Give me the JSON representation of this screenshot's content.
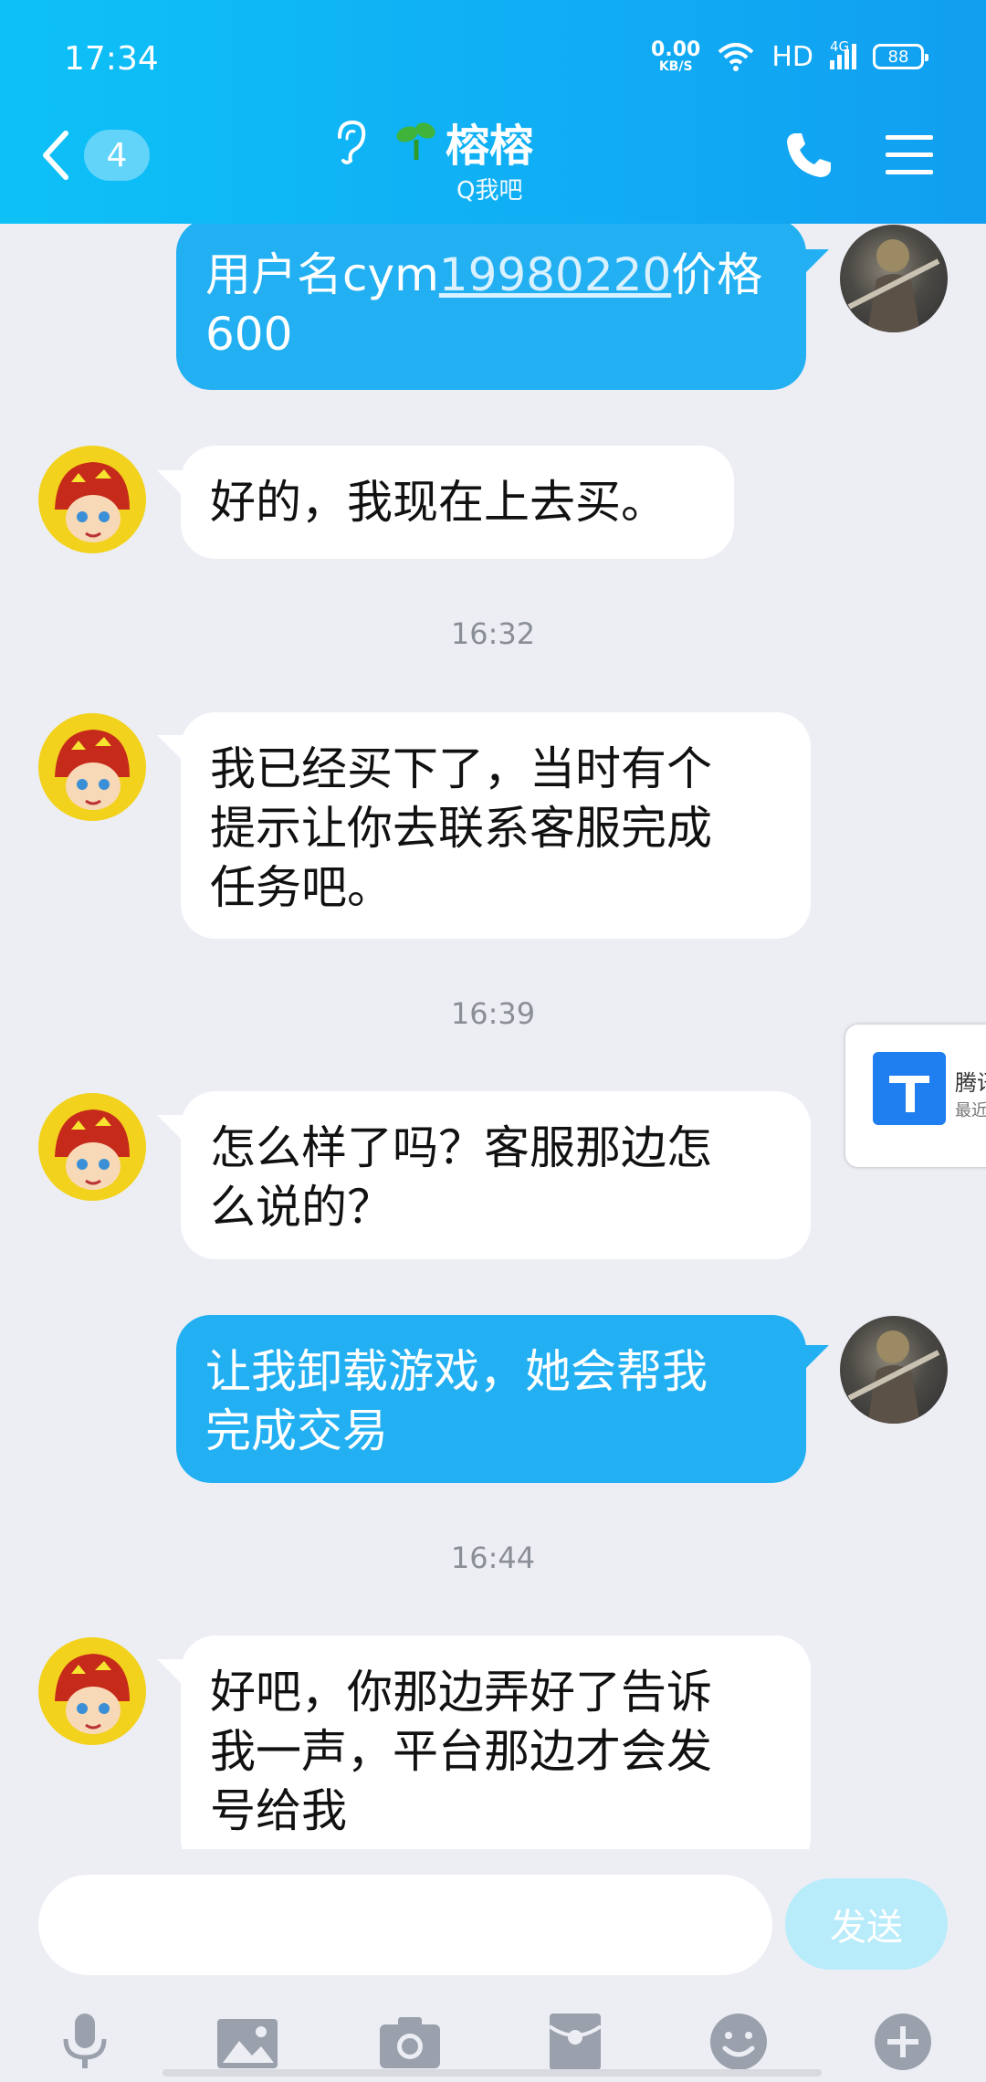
{
  "status_bar": {
    "time": "17:34",
    "net_speed": "0.00",
    "net_unit": "KB/S",
    "hd": "HD",
    "network": "4G",
    "battery": "88"
  },
  "header": {
    "unread_count": "4",
    "title": "榕榕",
    "subtitle": "Q我吧"
  },
  "messages": [
    {
      "from": "self",
      "text_prefix": "用户名cym",
      "link": "19980220",
      "text_suffix": "价格",
      "line2": "600"
    },
    {
      "from": "other",
      "text": "好的，我现在上去买。"
    },
    {
      "from": "other",
      "text_lines": [
        "我已经买下了，当时有个",
        "提示让你去联系客服完成",
        "任务吧。"
      ]
    },
    {
      "from": "other",
      "text_lines": [
        "怎么样了吗？客服那边怎",
        "么说的？"
      ]
    },
    {
      "from": "self",
      "text_lines": [
        "让我卸载游戏，她会帮我",
        "完成交易"
      ]
    },
    {
      "from": "other",
      "text_lines": [
        "好吧，你那边弄好了告诉",
        "我一声，平台那边才会发",
        "号给我"
      ]
    }
  ],
  "timestamps": [
    "16:32",
    "16:39",
    "16:44"
  ],
  "floating_card": {
    "title": "腾讯",
    "subtitle": "最近"
  },
  "input": {
    "value": "",
    "send_label": "发送"
  },
  "toolbar": [
    "microphone-icon",
    "image-icon",
    "camera-icon",
    "red-packet-icon",
    "emoji-icon",
    "plus-icon"
  ],
  "colors": {
    "header": "#10aef5",
    "self_bubble": "#22b0f2",
    "other_bubble": "#ffffff",
    "background": "#eceef4",
    "send_button": "#b8ecfb"
  }
}
